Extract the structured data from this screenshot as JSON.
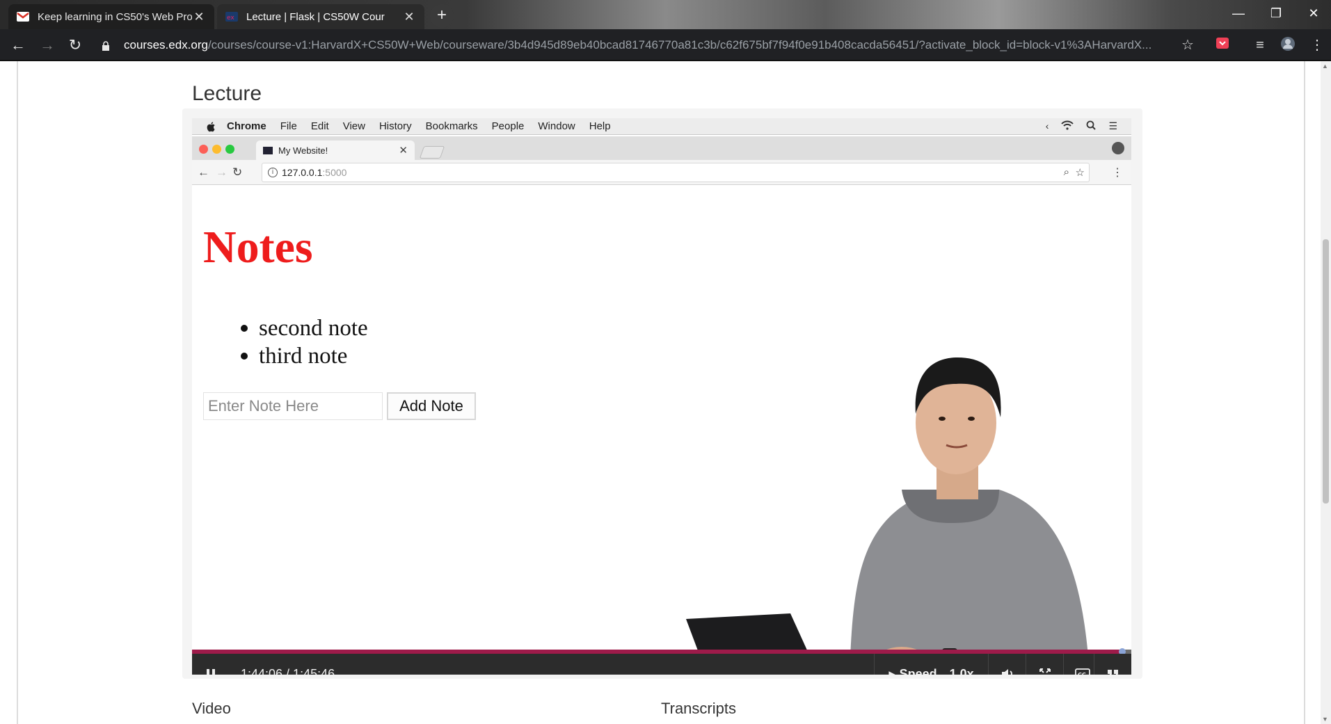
{
  "browser": {
    "tabs": [
      {
        "title": "Keep learning in CS50's Web Pro",
        "favicon": "gmail-icon",
        "active": false
      },
      {
        "title": "Lecture | Flask | CS50W Cour",
        "favicon": "edx-icon",
        "active": true
      }
    ],
    "address": {
      "host": "courses.edx.org",
      "path": "/courses/course-v1:HarvardX+CS50W+Web/courseware/3b4d945d89eb40bcad81746770a81c3b/c62f675bf7f94f0e91b408cacda56451/?activate_block_id=block-v1%3AHarvardX..."
    }
  },
  "page": {
    "section_title": "Lecture",
    "video": {
      "mac_menu": [
        "Chrome",
        "File",
        "Edit",
        "View",
        "History",
        "Bookmarks",
        "People",
        "Window",
        "Help"
      ],
      "inner_tab_title": "My Website!",
      "inner_url_host": "127.0.0.1",
      "inner_url_port": ":5000",
      "heading": "Notes",
      "notes": [
        "second note",
        "third note"
      ],
      "input_placeholder": "Enter Note Here",
      "button_label": "Add Note",
      "progress": 0.9905,
      "time": "1:44:06 / 1:45:46",
      "speed_label": "Speed",
      "speed_value": "1.0x"
    },
    "below": {
      "left_title": "Video",
      "right_title": "Transcripts"
    }
  },
  "colors": {
    "accent_progress": "#9e1b4a",
    "notes_heading": "#ee1c1c"
  }
}
